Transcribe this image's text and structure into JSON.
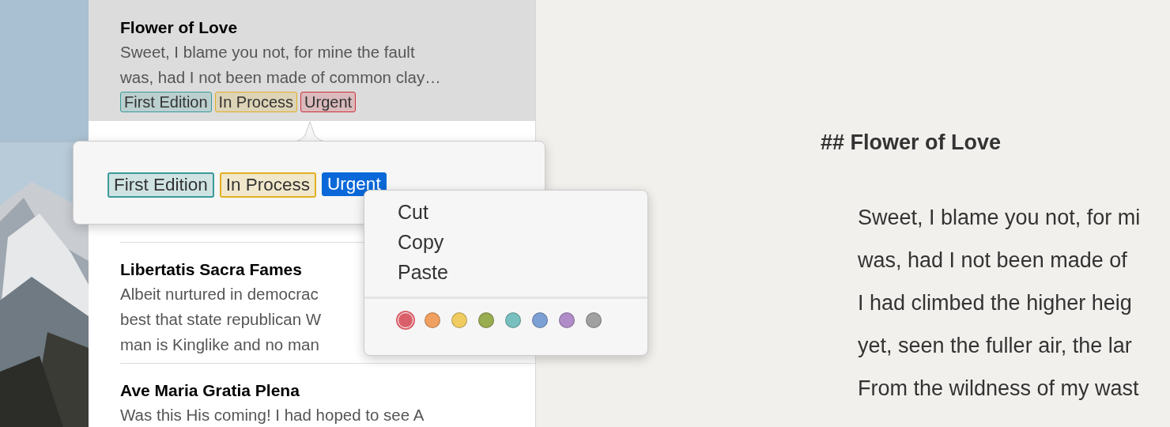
{
  "notes": [
    {
      "title": "Flower of Love",
      "preview": "Sweet, I blame you not, for mine the fault\nwas, had I not been made of common clay…",
      "selected": true,
      "tags": [
        {
          "label": "First Edition",
          "color": "#3a9a9a"
        },
        {
          "label": "In Process",
          "color": "#e0b020"
        },
        {
          "label": "Urgent",
          "color": "#d0303a"
        }
      ]
    },
    {
      "selected": false
    },
    {
      "title": "Libertatis Sacra Fames",
      "preview": "Albeit nurtured in democrac\nbest that state republican W\nman is Kinglike and no man",
      "selected": false
    },
    {
      "title": "Ave Maria Gratia Plena",
      "preview": "Was this His coming! I had hoped to see A",
      "selected": false
    }
  ],
  "tag_popover": {
    "tags": [
      {
        "label": "First Edition",
        "color": "#3a9a9a",
        "selected": false
      },
      {
        "label": "In Process",
        "color": "#e0b020",
        "selected": false
      },
      {
        "label": "Urgent",
        "selected": true
      }
    ]
  },
  "context_menu": {
    "items": [
      "Cut",
      "Copy",
      "Paste"
    ],
    "colors": [
      {
        "color": "#d9606a",
        "selected": true
      },
      {
        "color": "#f0a060",
        "selected": false
      },
      {
        "color": "#f0cc60",
        "selected": false
      },
      {
        "color": "#98ac50",
        "selected": false
      },
      {
        "color": "#78c0c0",
        "selected": false
      },
      {
        "color": "#7ca0d4",
        "selected": false
      },
      {
        "color": "#b08cc8",
        "selected": false
      },
      {
        "color": "#a0a0a0",
        "selected": false
      }
    ]
  },
  "editor": {
    "heading": "## Flower of Love",
    "lines": [
      "Sweet, I blame you not, for mi",
      "was, had I not been made of",
      "I had climbed the higher heig",
      "yet, seen the fuller air, the lar",
      "From the wildness of my wast"
    ]
  }
}
